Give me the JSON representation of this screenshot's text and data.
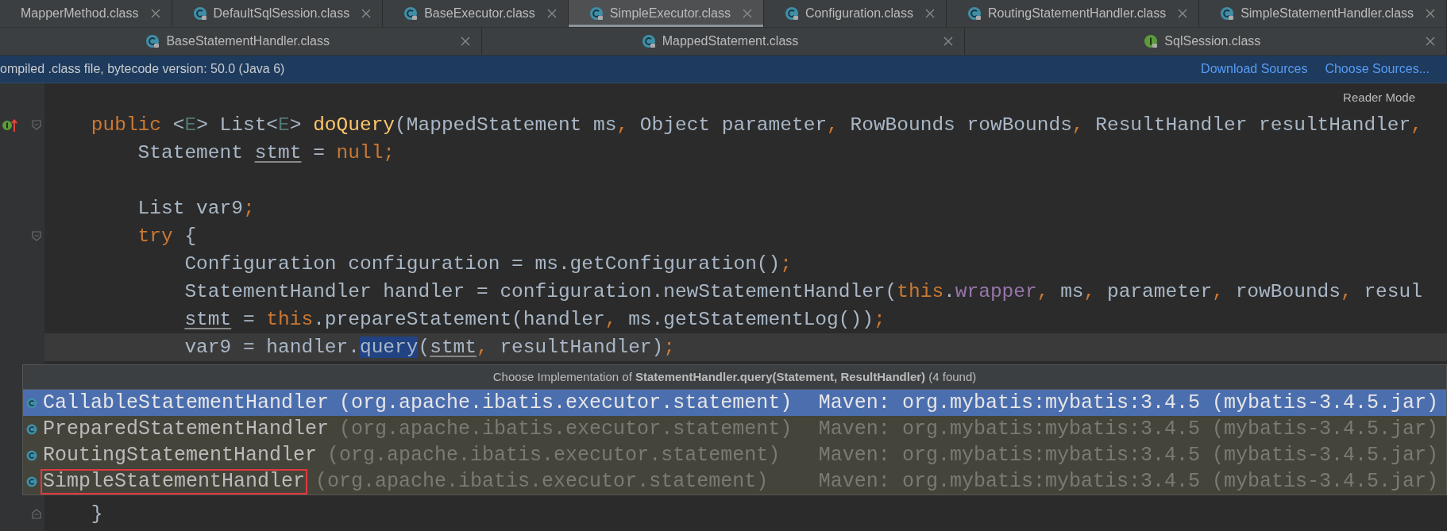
{
  "tabs": {
    "rows": [
      {
        "tabs": [
          {
            "label": "MapperMethod.class",
            "kind": "bare",
            "selected": false
          },
          {
            "label": "DefaultSqlSession.class",
            "kind": "class",
            "selected": false
          },
          {
            "label": "BaseExecutor.class",
            "kind": "class",
            "selected": false
          },
          {
            "label": "SimpleExecutor.class",
            "kind": "class",
            "selected": true
          },
          {
            "label": "Configuration.class",
            "kind": "class",
            "selected": false
          },
          {
            "label": "RoutingStatementHandler.class",
            "kind": "class",
            "selected": false
          },
          {
            "label": "SimpleStatementHandler.class",
            "kind": "class",
            "selected": false
          }
        ]
      },
      {
        "tabs": [
          {
            "label": "BaseStatementHandler.class",
            "kind": "class",
            "selected": false
          },
          {
            "label": "MappedStatement.class",
            "kind": "class",
            "selected": false
          },
          {
            "label": "SqlSession.class",
            "kind": "interface",
            "selected": false
          }
        ]
      }
    ]
  },
  "banner": {
    "text": "ompiled .class file, bytecode version: 50.0 (Java 6)",
    "links": [
      "Download Sources",
      "Choose Sources..."
    ]
  },
  "editor": {
    "reader_mode": "Reader Mode",
    "lines": [
      {
        "kind": "method-start",
        "current": false,
        "tokens": [
          {
            "text": "public",
            "kind": "keyword"
          },
          {
            "text": " <",
            "kind": "plain"
          },
          {
            "text": "E",
            "kind": "generic"
          },
          {
            "text": "> List<",
            "kind": "plain"
          },
          {
            "text": "E",
            "kind": "generic"
          },
          {
            "text": "> ",
            "kind": "plain"
          },
          {
            "text": "doQuery",
            "kind": "method"
          },
          {
            "text": "(MappedStatement ms",
            "kind": "plain"
          },
          {
            "text": ", ",
            "kind": "keyword"
          },
          {
            "text": "Object parameter",
            "kind": "plain"
          },
          {
            "text": ", ",
            "kind": "keyword"
          },
          {
            "text": "RowBounds rowBounds",
            "kind": "plain"
          },
          {
            "text": ", ",
            "kind": "keyword"
          },
          {
            "text": "ResultHandler resultHandler",
            "kind": "plain"
          },
          {
            "text": ",",
            "kind": "keyword"
          }
        ],
        "children": [
          {
            "current": false,
            "tokens": [
              {
                "text": "Statement ",
                "kind": "plain"
              },
              {
                "text": "stmt",
                "kind": "local"
              },
              {
                "text": " = ",
                "kind": "plain"
              },
              {
                "text": "null;",
                "kind": "keyword"
              }
            ]
          },
          {
            "current": false
          },
          {
            "current": false,
            "tokens": [
              {
                "text": "List var9",
                "kind": "plain"
              },
              {
                "text": ";",
                "kind": "keyword"
              }
            ]
          },
          {
            "kind": "fold-start",
            "current": false,
            "tokens": [
              {
                "text": "try",
                "kind": "keyword"
              },
              {
                "text": " {",
                "kind": "plain"
              }
            ],
            "children": [
              {
                "current": false,
                "tokens": [
                  {
                    "text": "Configuration configuration = ms.getConfiguration()",
                    "kind": "plain"
                  },
                  {
                    "text": ";",
                    "kind": "keyword"
                  }
                ]
              },
              {
                "current": false,
                "tokens": [
                  {
                    "text": "StatementHandler handler = configuration.newStatementHandler(",
                    "kind": "plain"
                  },
                  {
                    "text": "this",
                    "kind": "keyword"
                  },
                  {
                    "text": ".",
                    "kind": "plain"
                  },
                  {
                    "text": "wrapper",
                    "kind": "field"
                  },
                  {
                    "text": ", ",
                    "kind": "keyword"
                  },
                  {
                    "text": "ms",
                    "kind": "plain"
                  },
                  {
                    "text": ", ",
                    "kind": "keyword"
                  },
                  {
                    "text": "parameter",
                    "kind": "plain"
                  },
                  {
                    "text": ", ",
                    "kind": "keyword"
                  },
                  {
                    "text": "rowBounds",
                    "kind": "plain"
                  },
                  {
                    "text": ", ",
                    "kind": "keyword"
                  },
                  {
                    "text": "resul",
                    "kind": "plain"
                  }
                ]
              },
              {
                "current": false,
                "tokens": [
                  {
                    "text": "stmt",
                    "kind": "local"
                  },
                  {
                    "text": " = ",
                    "kind": "plain"
                  },
                  {
                    "text": "this",
                    "kind": "keyword"
                  },
                  {
                    "text": ".prepareStatement(handler",
                    "kind": "plain"
                  },
                  {
                    "text": ", ",
                    "kind": "keyword"
                  },
                  {
                    "text": "ms.getStatementLog())",
                    "kind": "plain"
                  },
                  {
                    "text": ";",
                    "kind": "keyword"
                  }
                ]
              },
              {
                "current": true,
                "tokens": [
                  {
                    "text": "var9 = handler.",
                    "kind": "plain"
                  },
                  {
                    "text": "query",
                    "kind": "highlight"
                  },
                  {
                    "text": "(",
                    "kind": "plain"
                  },
                  {
                    "text": "stmt",
                    "kind": "local"
                  },
                  {
                    "text": ", ",
                    "kind": "keyword"
                  },
                  {
                    "text": "resultHandler)",
                    "kind": "plain"
                  },
                  {
                    "text": ";",
                    "kind": "keyword"
                  }
                ]
              }
            ]
          }
        ]
      }
    ],
    "popup": {
      "title": "Choose Implementation of **StatementHandler.query(Statement, ResultHandler)** (4 found)",
      "items": [
        {
          "name": "CallableStatementHandler",
          "package": "(org.apache.ibatis.executor.statement)",
          "source": "Maven: org.mybatis:mybatis:3.4.5 (mybatis-3.4.5.jar)",
          "selected": true,
          "outlined": false
        },
        {
          "name": "PreparedStatementHandler",
          "package": "(org.apache.ibatis.executor.statement)",
          "source": "Maven: org.mybatis:mybatis:3.4.5 (mybatis-3.4.5.jar)",
          "selected": false,
          "outlined": false
        },
        {
          "name": "RoutingStatementHandler",
          "package": "(org.apache.ibatis.executor.statement)",
          "source": "Maven: org.mybatis:mybatis:3.4.5 (mybatis-3.4.5.jar)",
          "selected": false,
          "outlined": false
        },
        {
          "name": "SimpleStatementHandler",
          "package": "(org.apache.ibatis.executor.statement)",
          "source": "Maven: org.mybatis:mybatis:3.4.5 (mybatis-3.4.5.jar)",
          "selected": false,
          "outlined": true
        }
      ]
    },
    "lines_below": [
      {
        "kind": "fold-end",
        "current": false,
        "tokens": [
          {
            "text": "}",
            "kind": "plain"
          }
        ]
      }
    ]
  }
}
